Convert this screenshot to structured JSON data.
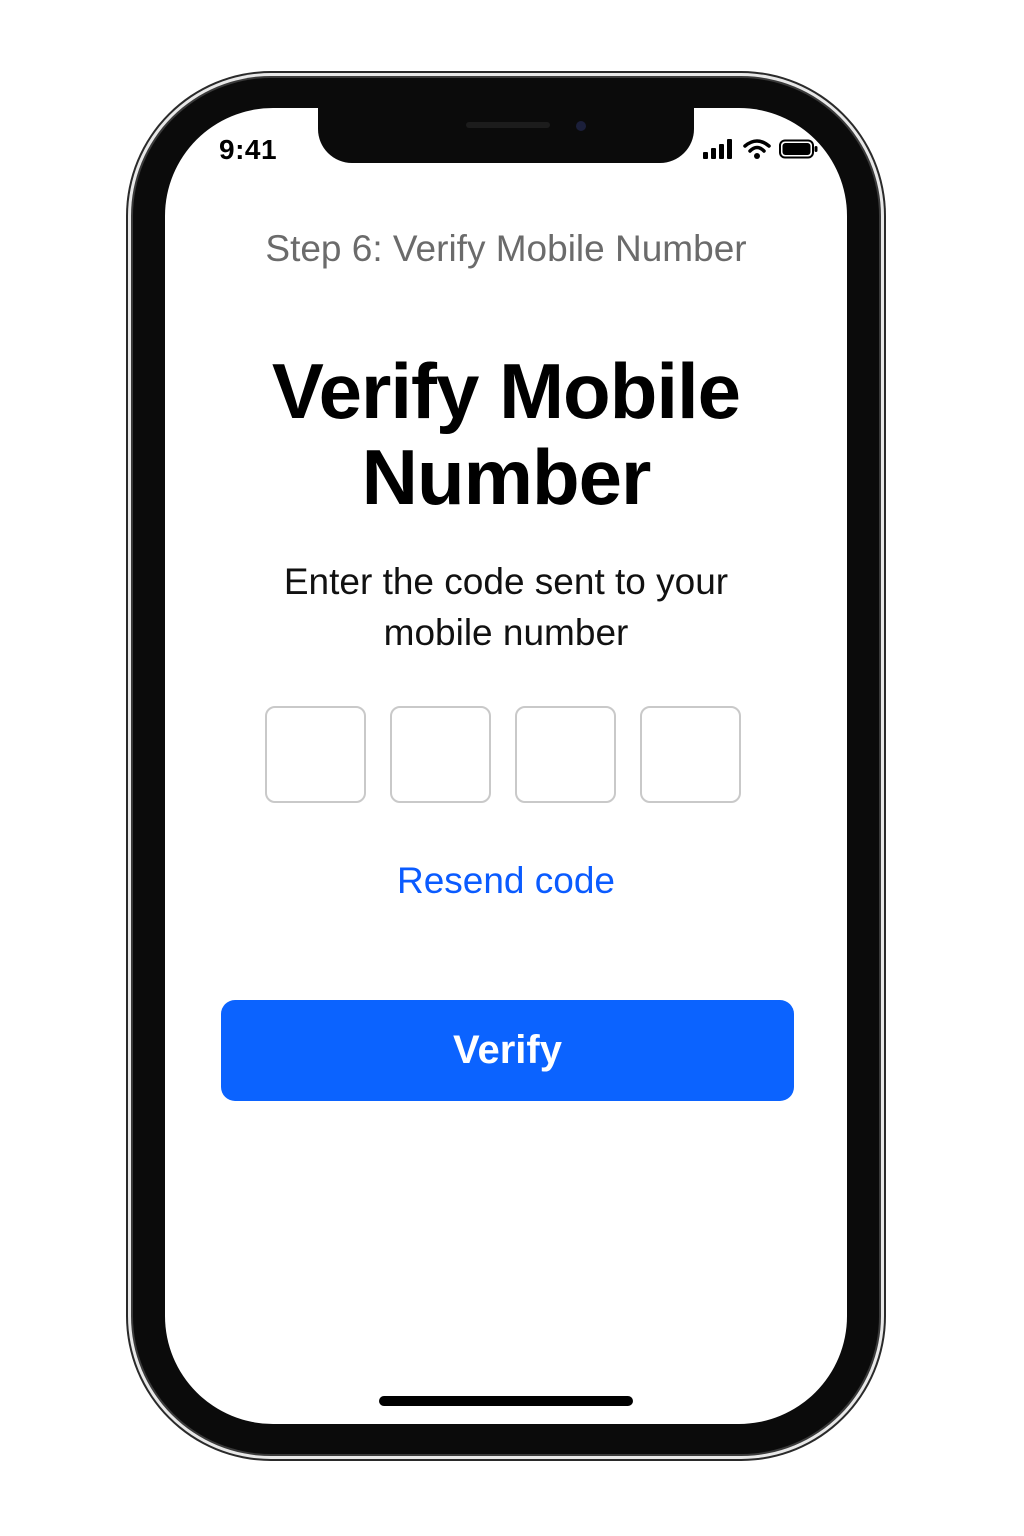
{
  "status_bar": {
    "time": "9:41",
    "icons": [
      "cellular-signal-icon",
      "wifi-icon",
      "battery-icon"
    ]
  },
  "step_label": "Step 6: Verify Mobile Number",
  "title": "Verify Mobile Number",
  "subtitle": "Enter the code sent to your mobile number",
  "code_inputs": [
    "",
    "",
    "",
    ""
  ],
  "resend_label": "Resend code",
  "verify_label": "Verify",
  "colors": {
    "accent": "#0b63ff",
    "link": "#0a5bff",
    "step_text": "#6b6b6b",
    "input_border": "#c9c9c9"
  }
}
